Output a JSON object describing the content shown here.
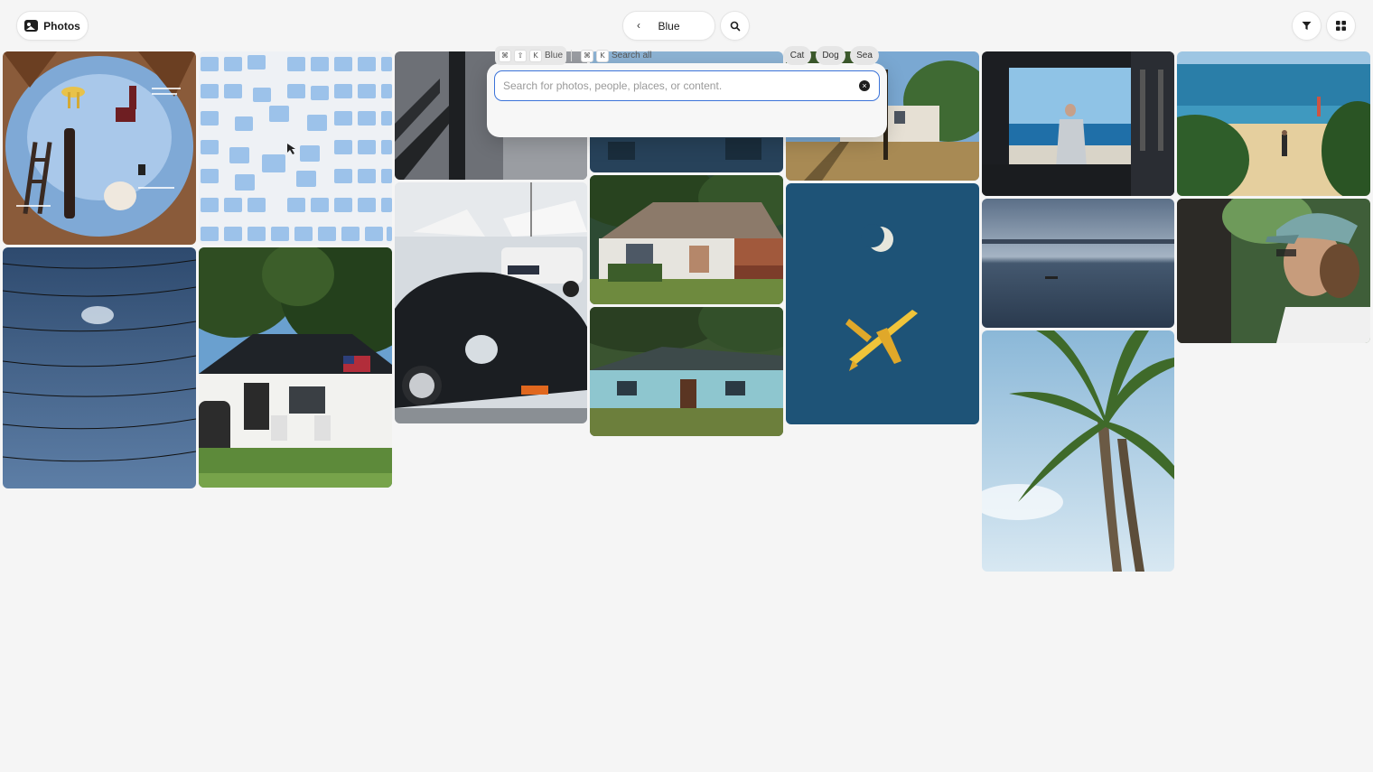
{
  "app": {
    "title": "Photos",
    "icon": "photo-icon"
  },
  "nav": {
    "back_icon": "chevron-left-icon",
    "current_label": "Blue"
  },
  "toolbar": {
    "search_icon": "search-icon",
    "filter_icon": "filter-icon",
    "view_icon": "grid-view-icon"
  },
  "search": {
    "placeholder": "Search for photos, people, places, or content.",
    "value": "",
    "clear_icon": "clear-icon",
    "shortcuts": [
      {
        "keys": [
          "⌘",
          "⇧",
          "K"
        ],
        "label": "Blue"
      },
      {
        "keys": [
          "⌘",
          "K"
        ],
        "label": "Search all"
      }
    ],
    "chips": [
      "Cat",
      "Dog",
      "Sea"
    ]
  },
  "photos": [
    {
      "name": "photo-chairs-floating",
      "subject": "floating chairs and ladder against sky"
    },
    {
      "name": "photo-blue-folders",
      "subject": "blue folder icons"
    },
    {
      "name": "photo-shadow-wall",
      "subject": "shadow on wall"
    },
    {
      "name": "photo-harbor",
      "subject": "harbor with cars"
    },
    {
      "name": "photo-white-house-trees",
      "subject": "house with trees"
    },
    {
      "name": "photo-window-ocean",
      "subject": "man at window facing ocean"
    },
    {
      "name": "photo-beach",
      "subject": "beach with person"
    },
    {
      "name": "photo-birds-on-wires",
      "subject": "birds on wires"
    },
    {
      "name": "photo-house-flag",
      "subject": "house with flag"
    },
    {
      "name": "photo-black-car",
      "subject": "black vintage car"
    },
    {
      "name": "photo-ranch-house",
      "subject": "ranch house"
    },
    {
      "name": "photo-moon-plane",
      "subject": "moon and airplane"
    },
    {
      "name": "photo-sea-dusk",
      "subject": "sea at dusk"
    },
    {
      "name": "photo-woman-cap",
      "subject": "woman with cap"
    },
    {
      "name": "photo-blue-house",
      "subject": "blue house"
    },
    {
      "name": "photo-palm-trees",
      "subject": "palm trees"
    }
  ]
}
